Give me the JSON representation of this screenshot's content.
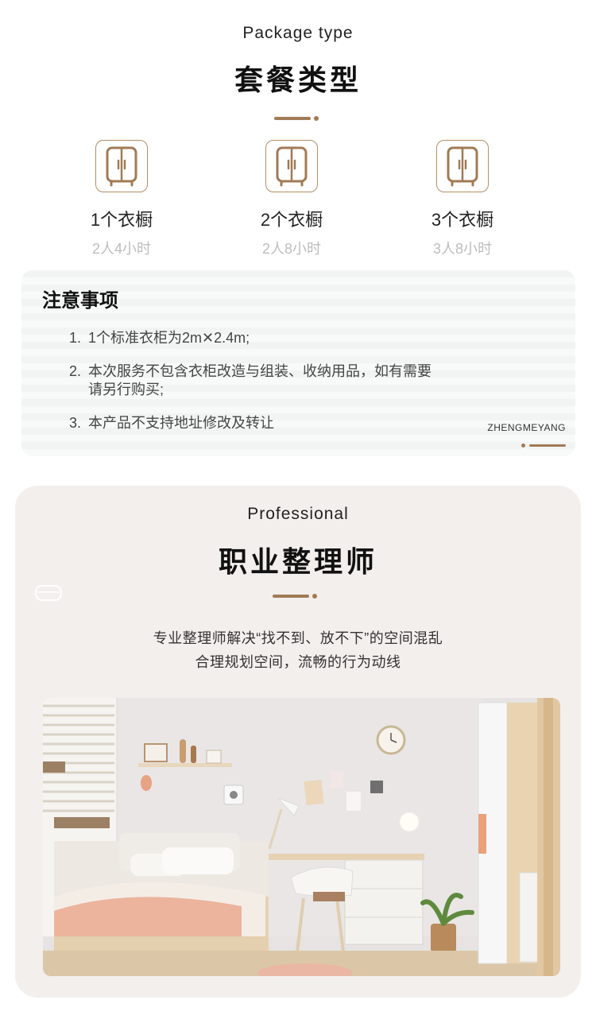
{
  "package": {
    "title_en": "Package type",
    "title_cn": "套餐类型",
    "items": [
      {
        "label": "1个衣橱",
        "sub": "2人4小时",
        "icon": "wardrobe-icon"
      },
      {
        "label": "2个衣橱",
        "sub": "2人8小时",
        "icon": "wardrobe-icon"
      },
      {
        "label": "3个衣橱",
        "sub": "3人8小时",
        "icon": "wardrobe-icon"
      }
    ]
  },
  "notice": {
    "title": "注意事项",
    "items": [
      {
        "num": "1.",
        "text": "1个标准衣柜为2m✕2.4m;"
      },
      {
        "num": "2.",
        "text": "本次服务不包含衣柜改造与组装、收纳用品，如有需要请另行购买;"
      },
      {
        "num": "3.",
        "text": "本产品不支持地址修改及转让"
      }
    ],
    "brand": "ZHENGMEYANG"
  },
  "professional": {
    "title_en": "Professional",
    "title_cn": "职业整理师",
    "desc_line1": "专业整理师解决“找不到、放不下”的空间混乱",
    "desc_line2": "合理规划空间，流畅的行为动线"
  },
  "colors": {
    "accent": "#a07b55",
    "icon_border": "#b38e66",
    "sub_text": "#bdbdbd",
    "pro_bg": "#f3efec"
  }
}
